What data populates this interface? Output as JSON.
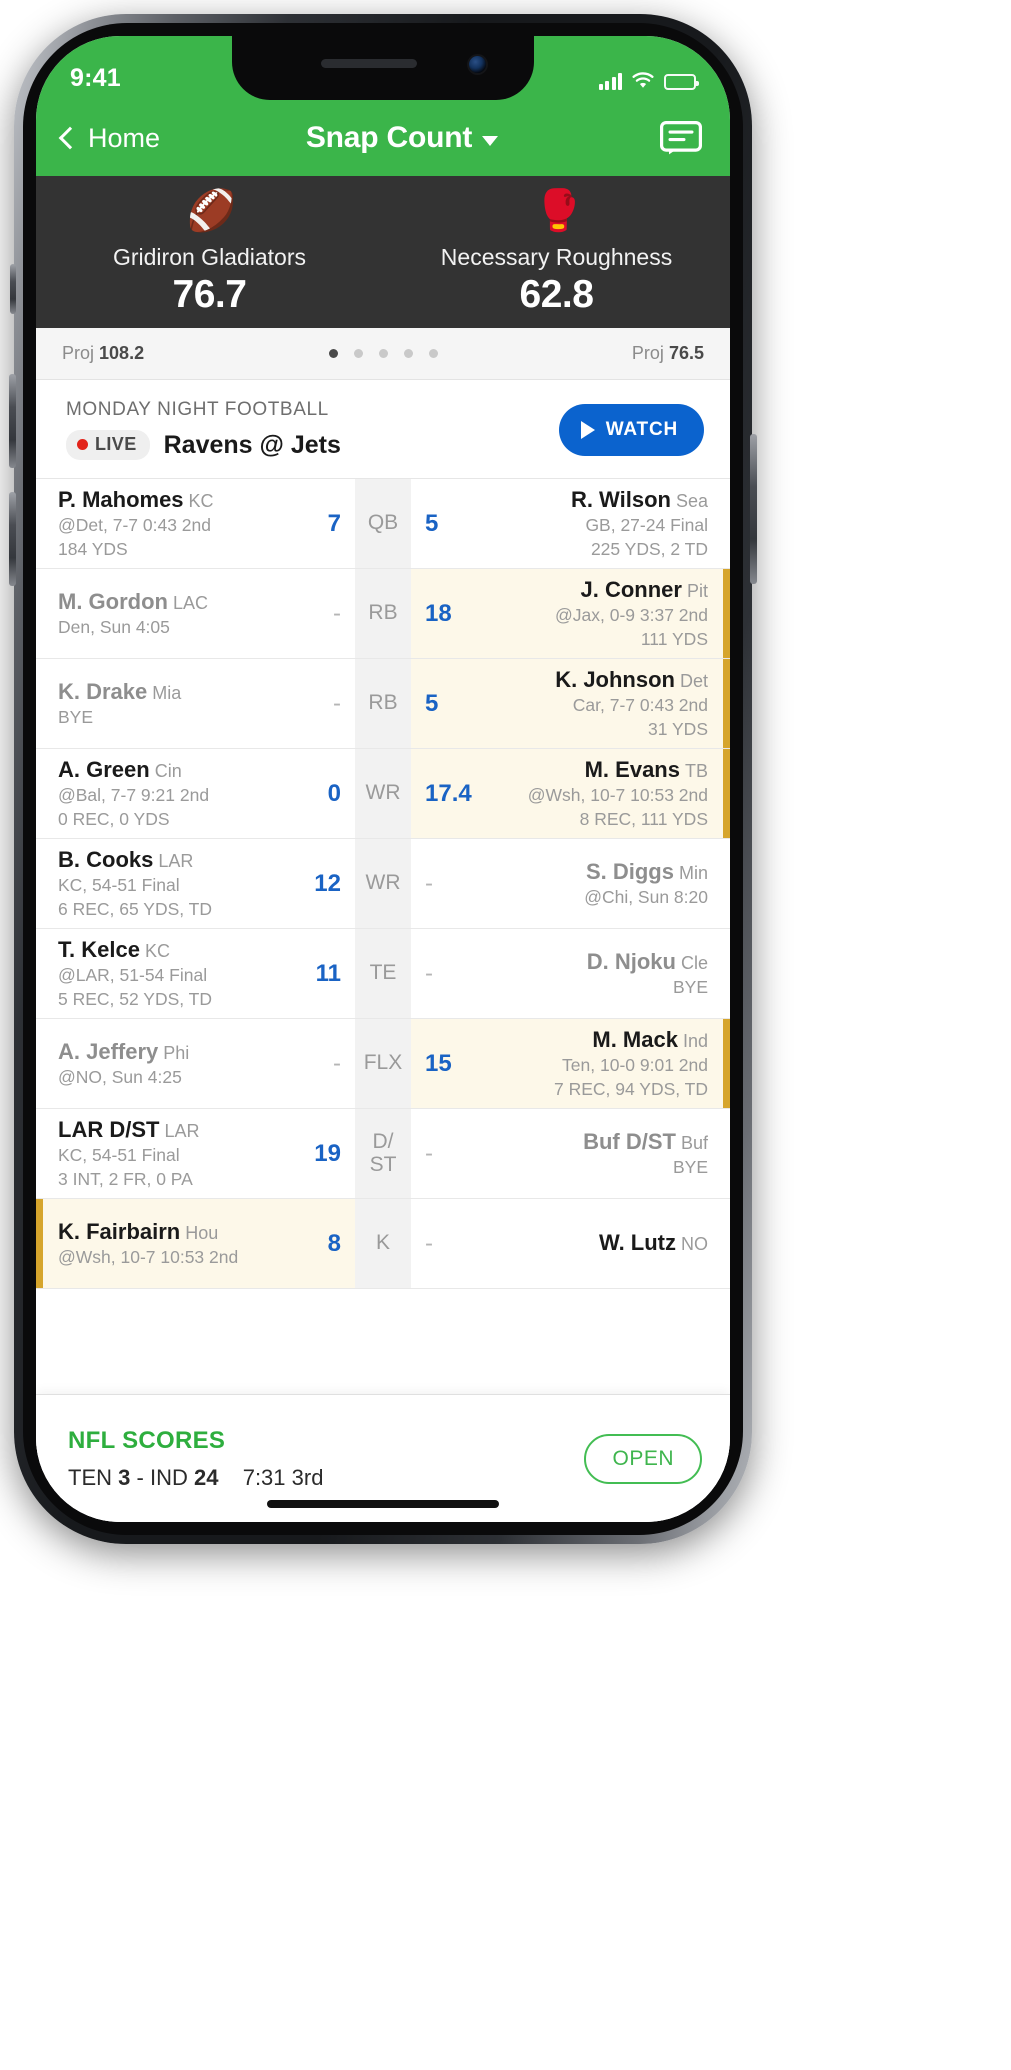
{
  "status_bar": {
    "time": "9:41",
    "signal_icon": "cellular-signal-icon",
    "wifi_icon": "wifi-icon",
    "battery_icon": "battery-icon"
  },
  "nav": {
    "back_label": "Home",
    "back_icon": "chevron-left-icon",
    "title": "Snap Count",
    "caret_icon": "chevron-down-icon",
    "chat_icon": "chat-bubble-icon"
  },
  "scoreboard": {
    "home": {
      "avatar_icon": "football-player-avatar",
      "name": "Gridiron Gladiators",
      "score": "76.7",
      "proj_label": "Proj",
      "proj_value": "108.2"
    },
    "away": {
      "avatar_icon": "boxing-glove-avatar",
      "name": "Necessary Roughness",
      "score": "62.8",
      "proj_label": "Proj",
      "proj_value": "76.5"
    },
    "pagination": {
      "count": 5,
      "active_index": 0
    }
  },
  "mnf": {
    "kicker": "MONDAY NIGHT FOOTBALL",
    "live_label": "LIVE",
    "matchup": "Ravens @ Jets",
    "watch_label": "WATCH",
    "watch_icon": "play-icon"
  },
  "colors": {
    "brand_green": "#3bb54a",
    "scoreboard_dark": "#333333",
    "score_blue": "#1a63c4",
    "watch_blue": "#0b63ce",
    "live_red": "#e2231a",
    "highlight_bg": "#fdf8e9",
    "highlight_bar": "#d6a52c",
    "scores_green": "#2eae3e"
  },
  "roster": [
    {
      "position": "QB",
      "left": {
        "name": "P. Mahomes",
        "team": "KC",
        "dim": false,
        "game": "@Det, 7-7 0:43 2nd",
        "stats": "184 YDS",
        "score": "7",
        "highlight": false
      },
      "right": {
        "name": "R. Wilson",
        "team": "Sea",
        "dim": false,
        "game": "GB, 27-24 Final",
        "stats": "225 YDS, 2 TD",
        "score": "5",
        "highlight": false
      }
    },
    {
      "position": "RB",
      "left": {
        "name": "M. Gordon",
        "team": "LAC",
        "dim": true,
        "game": "Den, Sun 4:05",
        "stats": "",
        "score": "-",
        "highlight": false
      },
      "right": {
        "name": "J. Conner",
        "team": "Pit",
        "dim": false,
        "game": "@Jax, 0-9 3:37 2nd",
        "stats": "111 YDS",
        "score": "18",
        "highlight": true
      }
    },
    {
      "position": "RB",
      "left": {
        "name": "K. Drake",
        "team": "Mia",
        "dim": true,
        "game": "BYE",
        "stats": "",
        "score": "-",
        "highlight": false
      },
      "right": {
        "name": "K. Johnson",
        "team": "Det",
        "dim": false,
        "game": "Car, 7-7 0:43 2nd",
        "stats": "31 YDS",
        "score": "5",
        "highlight": true
      }
    },
    {
      "position": "WR",
      "left": {
        "name": "A. Green",
        "team": "Cin",
        "dim": false,
        "game": "@Bal, 7-7 9:21 2nd",
        "stats": "0 REC, 0 YDS",
        "score": "0",
        "highlight": false
      },
      "right": {
        "name": "M. Evans",
        "team": "TB",
        "dim": false,
        "game": "@Wsh, 10-7 10:53 2nd",
        "stats": "8 REC, 111 YDS",
        "score": "17.4",
        "highlight": true
      }
    },
    {
      "position": "WR",
      "left": {
        "name": "B. Cooks",
        "team": "LAR",
        "dim": false,
        "game": "KC, 54-51 Final",
        "stats": "6 REC, 65 YDS, TD",
        "score": "12",
        "highlight": false
      },
      "right": {
        "name": "S. Diggs",
        "team": "Min",
        "dim": true,
        "game": "@Chi, Sun 8:20",
        "stats": "",
        "score": "-",
        "highlight": false
      }
    },
    {
      "position": "TE",
      "left": {
        "name": "T. Kelce",
        "team": "KC",
        "dim": false,
        "game": "@LAR, 51-54 Final",
        "stats": "5 REC, 52 YDS, TD",
        "score": "11",
        "highlight": false
      },
      "right": {
        "name": "D. Njoku",
        "team": "Cle",
        "dim": true,
        "game": "BYE",
        "stats": "",
        "score": "-",
        "highlight": false
      }
    },
    {
      "position": "FLX",
      "left": {
        "name": "A. Jeffery",
        "team": "Phi",
        "dim": true,
        "game": "@NO, Sun 4:25",
        "stats": "",
        "score": "-",
        "highlight": false
      },
      "right": {
        "name": "M. Mack",
        "team": "Ind",
        "dim": false,
        "game": "Ten, 10-0 9:01 2nd",
        "stats": "7 REC, 94 YDS, TD",
        "score": "15",
        "highlight": true
      }
    },
    {
      "position": "D/\nST",
      "left": {
        "name": "LAR D/ST",
        "team": "LAR",
        "dim": false,
        "game": "KC, 54-51 Final",
        "stats": "3 INT, 2 FR, 0 PA",
        "score": "19",
        "highlight": false
      },
      "right": {
        "name": "Buf D/ST",
        "team": "Buf",
        "dim": true,
        "game": "BYE",
        "stats": "",
        "score": "-",
        "highlight": false
      }
    },
    {
      "position": "K",
      "left": {
        "name": "K. Fairbairn",
        "team": "Hou",
        "dim": false,
        "game": "@Wsh, 10-7 10:53 2nd",
        "stats": "",
        "score": "8",
        "highlight": true
      },
      "right": {
        "name": "W. Lutz",
        "team": "NO",
        "dim": false,
        "game": "",
        "stats": "",
        "score": "-",
        "highlight": false
      }
    }
  ],
  "promo": {
    "title": "NFL SCORES",
    "away_team": "TEN",
    "away_score": "3",
    "sep": "-",
    "home_team": "IND",
    "home_score": "24",
    "clock": "7:31 3rd",
    "open_label": "OPEN"
  }
}
